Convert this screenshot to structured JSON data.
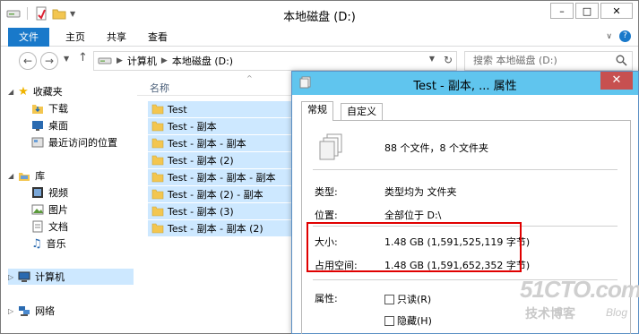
{
  "window": {
    "title": "本地磁盘 (D:)",
    "min_label": "–",
    "max_label": "□",
    "close_label": "✕"
  },
  "ribbon": {
    "tabs": [
      "文件",
      "主页",
      "共享",
      "查看"
    ]
  },
  "address": {
    "segments": [
      "计算机",
      "本地磁盘 (D:)"
    ],
    "search_placeholder": "搜索 本地磁盘 (D:)"
  },
  "nav": {
    "favorites_label": "收藏夹",
    "favorites": [
      "下载",
      "桌面",
      "最近访问的位置"
    ],
    "libraries_label": "库",
    "libraries": [
      "视频",
      "图片",
      "文档",
      "音乐"
    ],
    "computer_label": "计算机",
    "network_label": "网络"
  },
  "filelist": {
    "column_name": "名称",
    "items": [
      "Test",
      "Test - 副本",
      "Test - 副本 - 副本",
      "Test - 副本 (2)",
      "Test - 副本 - 副本 - 副本",
      "Test - 副本 (2) - 副本",
      "Test - 副本 (3)",
      "Test - 副本 - 副本 (2)"
    ]
  },
  "properties": {
    "title": "Test - 副本, ... 属性",
    "close_label": "✕",
    "tabs": [
      "常规",
      "自定义"
    ],
    "summary": "88 个文件，8 个文件夹",
    "type_label": "类型:",
    "type_value": "类型均为 文件夹",
    "location_label": "位置:",
    "location_value": "全部位于 D:\\",
    "size_label": "大小:",
    "size_value": "1.48 GB (1,591,525,119 字节)",
    "disk_size_label": "占用空间:",
    "disk_size_value": "1.48 GB (1,591,652,352 字节)",
    "attributes_label": "属性:",
    "readonly_label": "只读(R)",
    "hidden_label": "隐藏(H)",
    "highlight_color": "#e00000"
  },
  "watermark": {
    "main": "51CTO.com",
    "sub": "技术博客",
    "blog": "Blog"
  }
}
